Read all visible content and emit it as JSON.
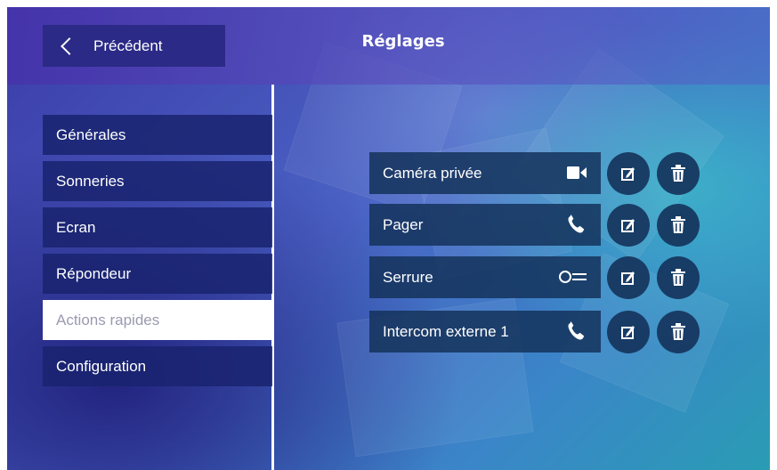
{
  "header": {
    "back_label": "Précédent",
    "title": "Réglages"
  },
  "sidebar": {
    "items": [
      {
        "label": "Générales",
        "active": false
      },
      {
        "label": "Sonneries",
        "active": false
      },
      {
        "label": "Ecran",
        "active": false
      },
      {
        "label": "Répondeur",
        "active": false
      },
      {
        "label": "Actions rapides",
        "active": true
      },
      {
        "label": "Configuration",
        "active": false
      }
    ]
  },
  "actions": [
    {
      "label": "Caméra privée",
      "icon": "video-camera-icon"
    },
    {
      "label": "Pager",
      "icon": "phone-icon"
    },
    {
      "label": "Serrure",
      "icon": "key-icon"
    },
    {
      "label": "Intercom externe 1",
      "icon": "phone-icon"
    }
  ],
  "colors": {
    "button_dark": "#2b2a86",
    "active_bg": "#ffffff",
    "active_text": "#9a9ab0"
  }
}
